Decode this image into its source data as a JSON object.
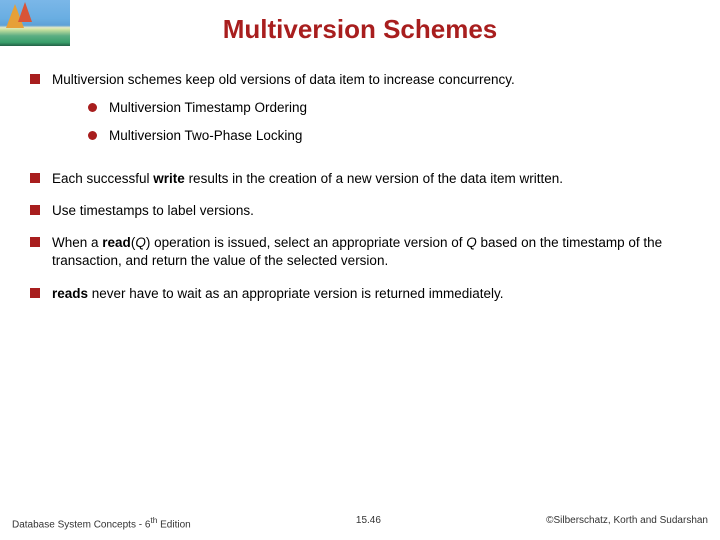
{
  "title": "Multiversion Schemes",
  "bullets": {
    "b1": {
      "text": "Multiversion schemes keep old versions of data item to increase concurrency.",
      "sub1": "Multiversion Timestamp Ordering",
      "sub2": "Multiversion Two-Phase Locking"
    },
    "b2_pre": "Each successful ",
    "b2_bold": "write",
    "b2_post": " results in the creation of a new version of the data item written.",
    "b3": "Use timestamps to label versions.",
    "b4_pre": "When a ",
    "b4_bold": "read",
    "b4_mid1": "(",
    "b4_q1": "Q",
    "b4_mid2": ") operation is issued, select an appropriate version of ",
    "b4_q2": "Q",
    "b4_post": " based on the timestamp of the transaction, and return the value of the selected version.",
    "b5_bold": "reads",
    "b5_post": " never have to wait as an appropriate version is returned immediately."
  },
  "footer": {
    "left_pre": "Database System Concepts - 6",
    "left_sup": "th",
    "left_post": " Edition",
    "center": "15.46",
    "right": "©Silberschatz, Korth and Sudarshan"
  }
}
